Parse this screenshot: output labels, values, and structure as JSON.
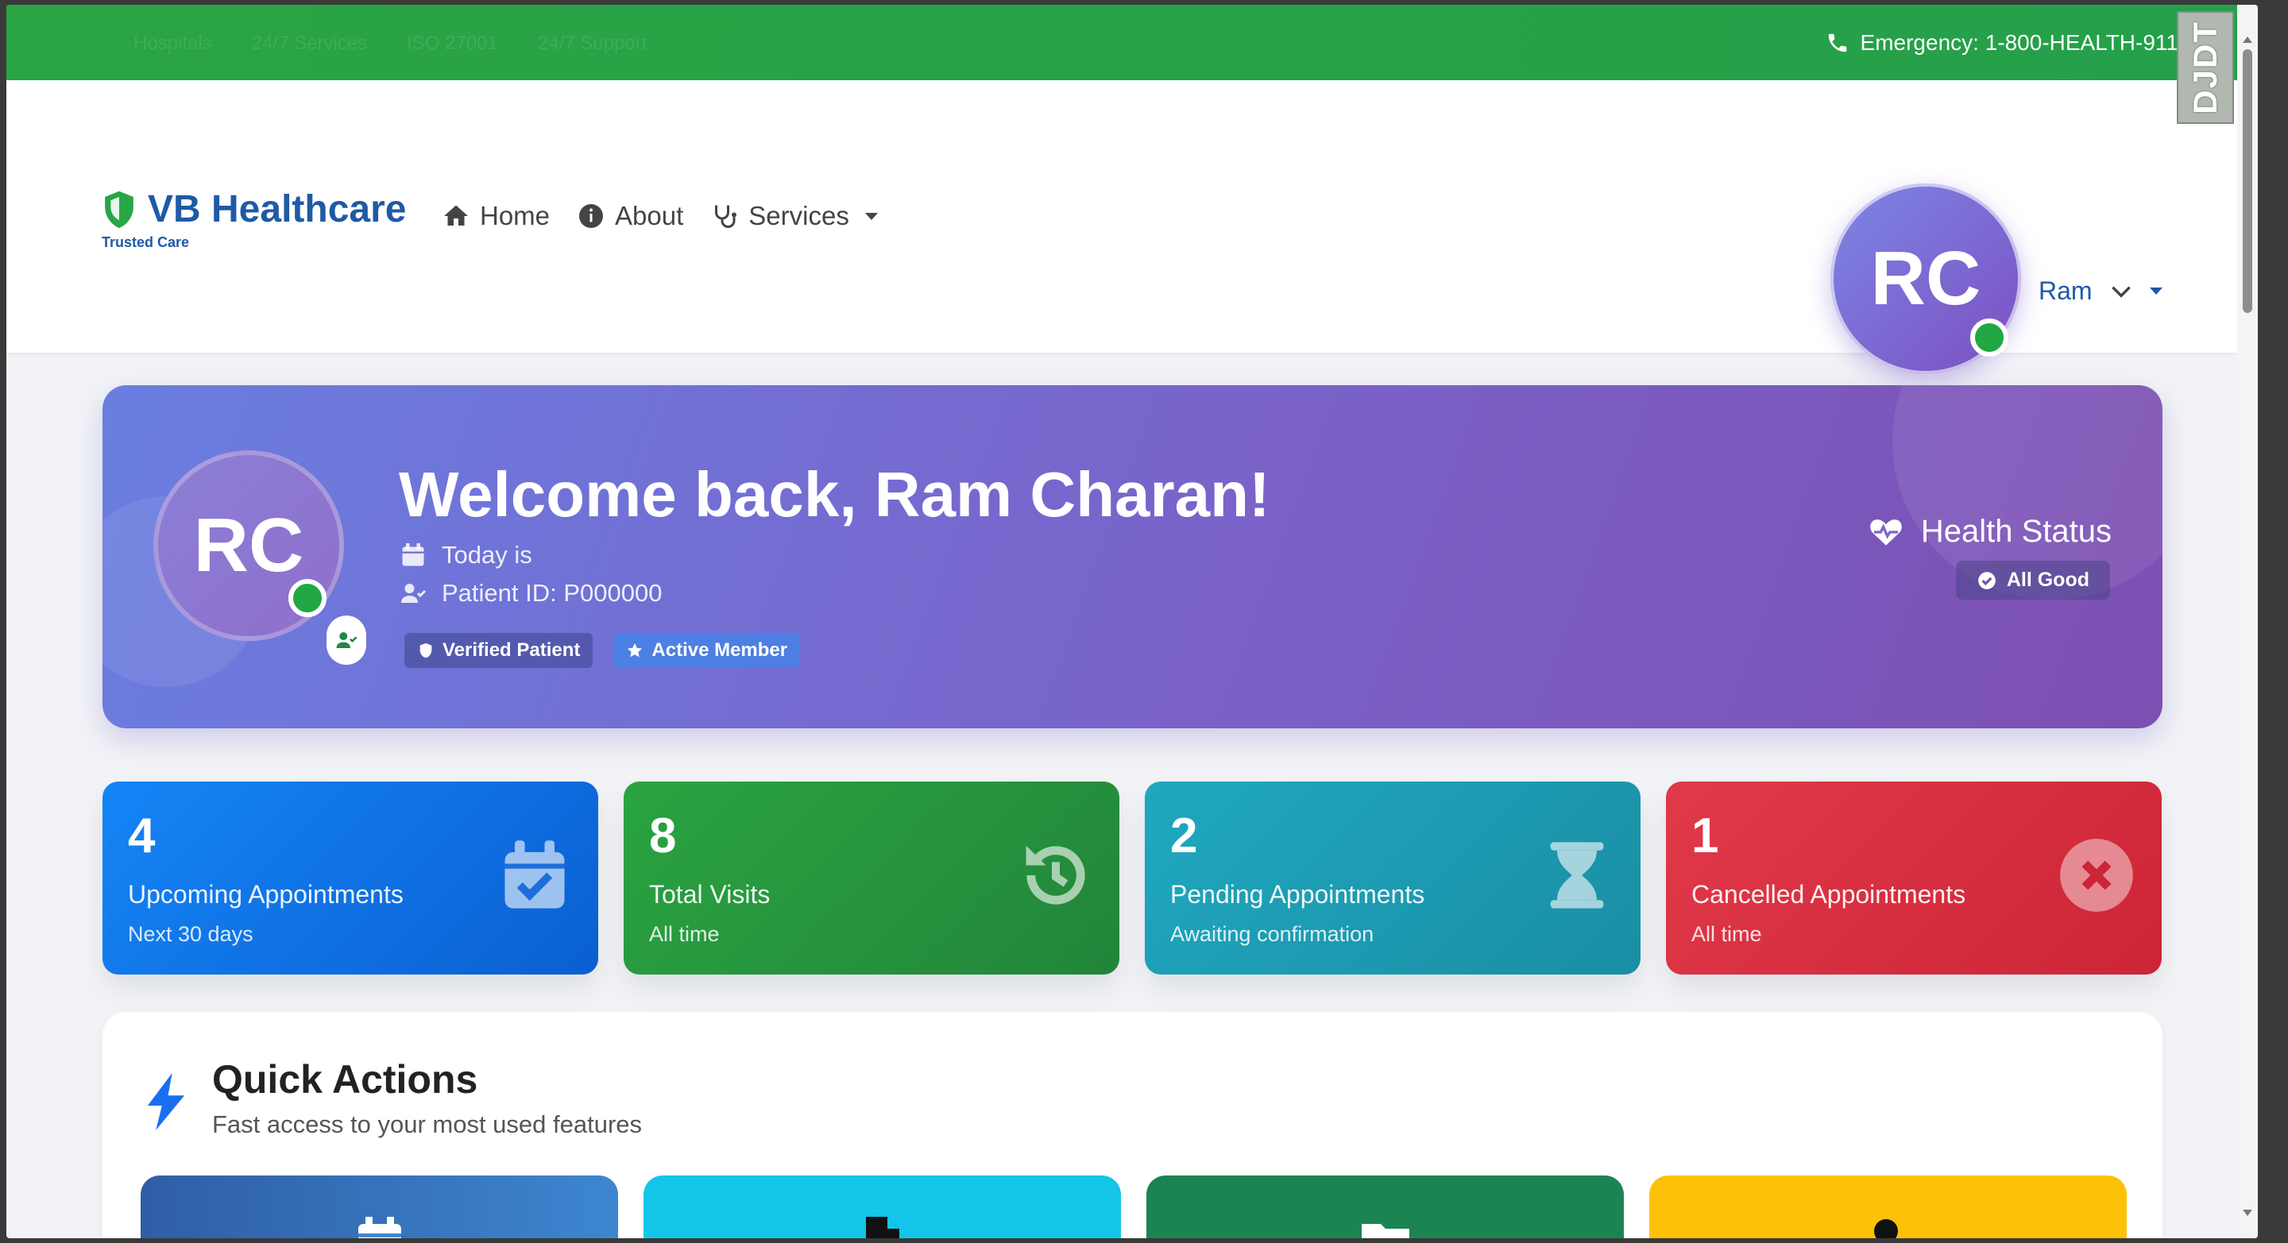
{
  "topbar": {
    "faint_items": [
      "Hospitals",
      "24/7 Services",
      "ISO 27001",
      "24/7 Support"
    ],
    "emergency": "Emergency: 1-800-HEALTH-911"
  },
  "brand": {
    "name": "VB Healthcare",
    "tagline": "Trusted Care"
  },
  "nav": {
    "home": "Home",
    "about": "About",
    "services": "Services",
    "avatar_initials": "RC",
    "user_name": "Ram"
  },
  "welcome": {
    "initials": "RC",
    "title": "Welcome back, Ram Charan!",
    "today_label": "Today is",
    "patient_id": "Patient ID: P000000",
    "badge_verified": "Verified Patient",
    "badge_active": "Active Member",
    "health_title": "Health Status",
    "health_value": "All Good"
  },
  "stats": [
    {
      "value": "4",
      "label": "Upcoming Appointments",
      "sub": "Next 30 days",
      "icon": "calendar-check-icon"
    },
    {
      "value": "8",
      "label": "Total Visits",
      "sub": "All time",
      "icon": "history-icon"
    },
    {
      "value": "2",
      "label": "Pending Appointments",
      "sub": "Awaiting confirmation",
      "icon": "hourglass-icon"
    },
    {
      "value": "1",
      "label": "Cancelled Appointments",
      "sub": "All time",
      "icon": "x-circle-icon"
    }
  ],
  "quick_actions": {
    "title": "Quick Actions",
    "subtitle": "Fast access to your most used features",
    "cards": [
      {
        "icon": "calendar-icon",
        "color": "#2f5ea6"
      },
      {
        "icon": "file-icon",
        "color": "#13c6ea"
      },
      {
        "icon": "folder-icon",
        "color": "#1a8553"
      },
      {
        "icon": "user-icon",
        "color": "#fdc107"
      }
    ]
  },
  "extension_badge": "DJDT",
  "colors": {
    "topbar_green": "#2aa444",
    "brand_blue": "#1f5aa6",
    "banner_start": "#6a7ee0",
    "banner_end": "#7c4fb2",
    "online_green": "#22a745"
  }
}
